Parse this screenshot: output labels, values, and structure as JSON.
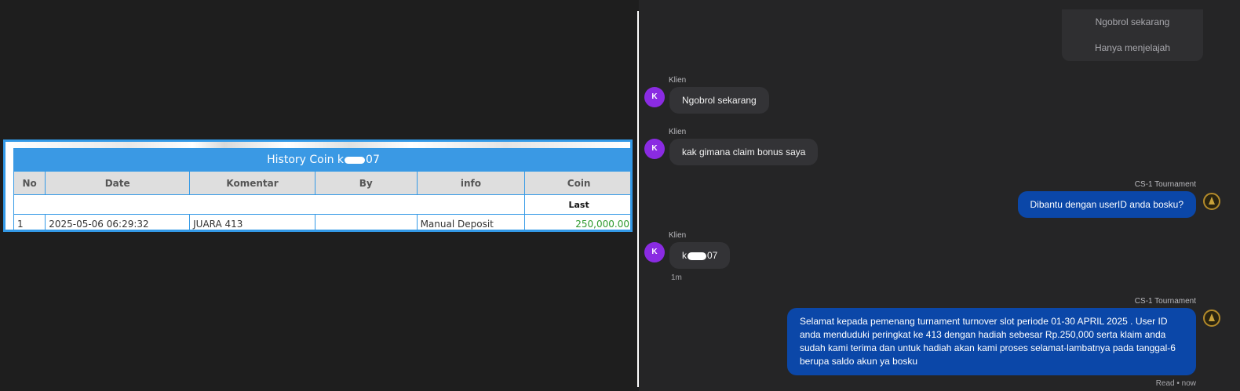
{
  "history": {
    "title_prefix": "History Coin k",
    "title_suffix": "07",
    "columns": [
      "No",
      "Date",
      "Komentar",
      "By",
      "info",
      "Coin"
    ],
    "sub_label": "Last",
    "rows": [
      {
        "no": "1",
        "date": "2025-05-06 06:29:32",
        "komentar": "JUARA 413",
        "by": "",
        "info": "Manual Deposit",
        "coin": "250,000.00"
      }
    ]
  },
  "chat": {
    "quick_options": [
      "Ngobrol sekarang",
      "Hanya menjelajah"
    ],
    "client_name": "Klien",
    "client_initial": "K",
    "agent_name": "CS-1 Tournament",
    "messages": [
      {
        "text": "Ngobrol sekarang"
      },
      {
        "text": "kak gimana claim bonus saya"
      },
      {
        "text": "Dibantu dengan userID anda bosku?"
      },
      {
        "prefix": "k",
        "suffix": "07",
        "time": "1m"
      },
      {
        "text": "Selamat kepada pemenang turnament turnover slot periode 01-30 APRIL 2025 . User ID anda menduduki peringkat ke 413 dengan hadiah sebesar Rp.250,000 serta klaim anda sudah kami terima dan untuk hadiah akan kami proses selamat-lambatnya pada tanggal-6 berupa saldo akun ya bosku"
      }
    ],
    "read_status": "Read • now"
  }
}
